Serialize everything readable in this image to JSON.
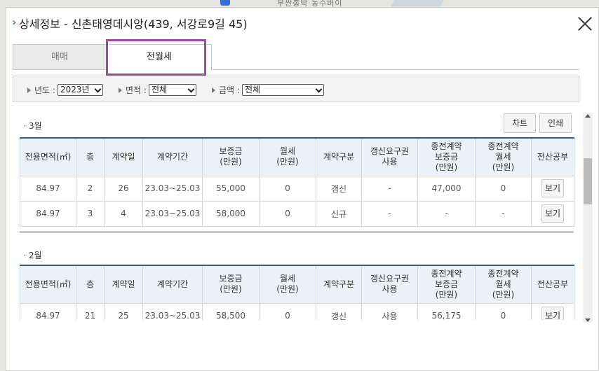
{
  "map": {
    "top_text": "부싼총박    동수버이"
  },
  "dialog": {
    "title": "상세정보 - 신촌태영데시앙(439, 서강로9길 45)"
  },
  "tabs": [
    {
      "label": "매매",
      "active": false
    },
    {
      "label": "전월세",
      "active": true
    }
  ],
  "filters": {
    "year": {
      "label": "년도 :",
      "value": "2023년"
    },
    "area": {
      "label": "면적 :",
      "value": "전체"
    },
    "amount": {
      "label": "금액 :",
      "value": "전체"
    }
  },
  "buttons": {
    "chart": "차트",
    "print": "인쇄",
    "view": "보기"
  },
  "columns": [
    "전용면적(㎡)",
    "층",
    "계약일",
    "계약기간",
    "보증금\n(만원)",
    "월세\n(만원)",
    "계약구분",
    "갱신요구권\n사용",
    "종전계약\n보증금\n(만원)",
    "종전계약\n월세\n(만원)",
    "전산공부"
  ],
  "sections": [
    {
      "month": "ㆍ3월",
      "rows": [
        [
          "84.97",
          "2",
          "26",
          "23.03~25.03",
          "55,000",
          "0",
          "갱신",
          "-",
          "47,000",
          "0"
        ],
        [
          "84.97",
          "3",
          "4",
          "23.03~25.03",
          "58,000",
          "0",
          "신규",
          "-",
          "-",
          "-"
        ]
      ]
    },
    {
      "month": "ㆍ2월",
      "rows": [
        [
          "84.97",
          "21",
          "25",
          "23.03~25.03",
          "58,500",
          "0",
          "갱신",
          "사용",
          "56,175",
          "0"
        ]
      ]
    }
  ]
}
